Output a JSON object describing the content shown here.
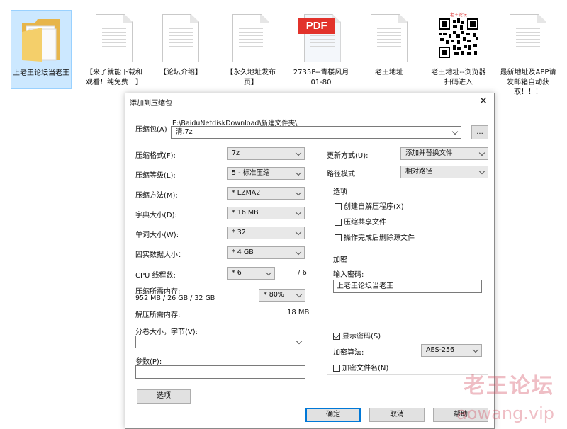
{
  "desktop": {
    "files": [
      {
        "label": "上老王论坛当老王",
        "type": "folder"
      },
      {
        "label": "【来了就能下载和观看！纯免费！】",
        "type": "doc"
      },
      {
        "label": "【论坛介绍】",
        "type": "doc"
      },
      {
        "label": "【永久地址发布页】",
        "type": "doc"
      },
      {
        "label": "2735P--青楼风月01-80",
        "type": "pdf",
        "badge": "PDF"
      },
      {
        "label": "老王地址",
        "type": "doc"
      },
      {
        "label": "老王地址--浏览器扫码进入",
        "type": "qr",
        "caption": "老王论坛"
      },
      {
        "label": "最新地址及APP请发邮箱自动获取！！！",
        "type": "doc"
      }
    ]
  },
  "dialog": {
    "title": "添加到压缩包",
    "archive_label": "压缩包(A)",
    "archive_path": "E:\\BaiduNetdiskDownload\\新建文件夹\\",
    "archive_name": "清.7z",
    "browse_label": "...",
    "format_label": "压缩格式(F):",
    "format_value": "7z",
    "level_label": "压缩等级(L):",
    "level_value": "5 - 标准压缩",
    "method_label": "压缩方法(M):",
    "method_value": "* LZMA2",
    "dict_label": "字典大小(D):",
    "dict_value": "* 16 MB",
    "word_label": "单词大小(W):",
    "word_value": "* 32",
    "solid_label": "固实数据大小：",
    "solid_value": "* 4 GB",
    "cpu_label": "CPU 线程数:",
    "cpu_value": "* 6",
    "cpu_max": "/ 6",
    "mem_label": "压缩所需内存:",
    "mem_value": "952 MB / 26 GB / 32 GB",
    "mem_percent": "* 80%",
    "decomp_label": "解压所需内存:",
    "decomp_value": "18 MB",
    "volume_label": "分卷大小，字节(V):",
    "params_label": "参数(P):",
    "options_button": "选项",
    "update_label": "更新方式(U):",
    "update_value": "添加并替换文件",
    "path_label": "路径模式",
    "path_value": "相对路径",
    "options_group": "选项",
    "opt_sfx": "创建自解压程序(X)",
    "opt_shared": "压缩共享文件",
    "opt_delete": "操作完成后删除源文件",
    "encrypt_group": "加密",
    "password_label": "输入密码:",
    "password_value": "上老王论坛当老王",
    "show_password": "显示密码(S)",
    "algo_label": "加密算法:",
    "algo_value": "AES-256",
    "encrypt_names": "加密文件名(N)",
    "ok": "确定",
    "cancel": "取消",
    "help": "帮助"
  },
  "watermark": {
    "line1": "老王论坛",
    "line2": "aowang.vip"
  }
}
